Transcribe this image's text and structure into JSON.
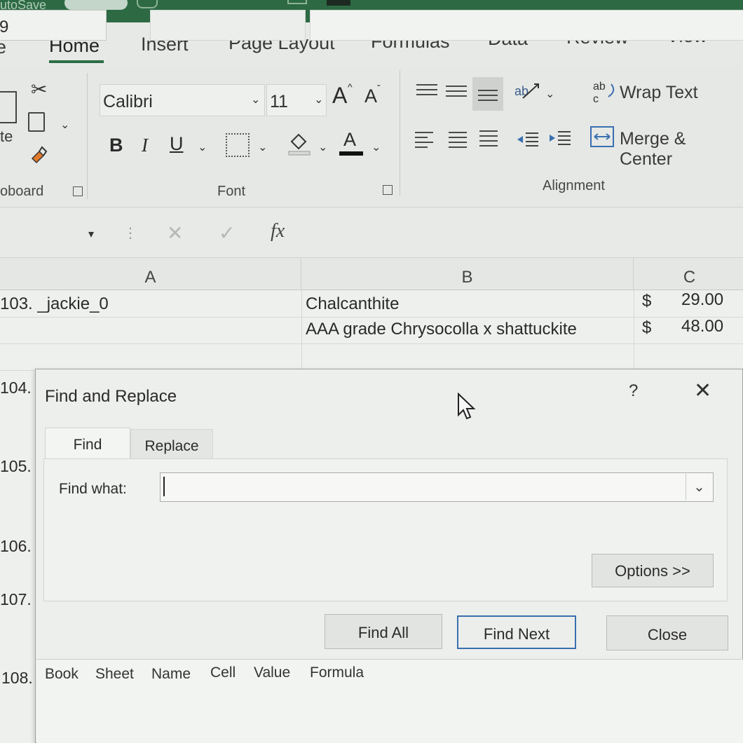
{
  "title_bar": {
    "autosave_label": "utoSave",
    "autosave_state": "Off"
  },
  "tabs": [
    {
      "label": "e"
    },
    {
      "label": "Home"
    },
    {
      "label": "Insert"
    },
    {
      "label": "Page Layout"
    },
    {
      "label": "Formulas"
    },
    {
      "label": "Data"
    },
    {
      "label": "Review"
    },
    {
      "label": "View"
    }
  ],
  "ribbon": {
    "clipboard": {
      "paste_label": "te",
      "group_label": "oboard"
    },
    "font": {
      "name": "Calibri",
      "size": "11",
      "bold": "B",
      "italic": "I",
      "underline": "U",
      "font_color_letter": "A",
      "grow_letter": "A",
      "shrink_letter": "A",
      "group_label": "Font"
    },
    "alignment": {
      "wrap_text": "Wrap Text",
      "merge_center": "Merge & Center",
      "group_label": "Alignment"
    }
  },
  "formula_bar": {
    "name_box": "9",
    "fx": "fx",
    "formula": ""
  },
  "sheet": {
    "columns": [
      "A",
      "B",
      "C"
    ],
    "rows": [
      {
        "a": "103. _jackie_0",
        "b": "Chalcanthite",
        "c_symbol": "$",
        "c_value": "29.00"
      },
      {
        "a": "",
        "b": "AAA grade Chrysocolla x shattuckite",
        "c_symbol": "$",
        "c_value": "48.00"
      }
    ],
    "row_labels": [
      "104.",
      "105.",
      "106.",
      "107.",
      "108."
    ]
  },
  "dialog": {
    "title": "Find and Replace",
    "help": "?",
    "close_glyph": "✕",
    "tabs": [
      "Find",
      "Replace"
    ],
    "find_what_label": "Find what:",
    "find_what_value": "",
    "options_button": "Options >>",
    "find_all_button": "Find All",
    "find_next_button": "Find Next",
    "close_button": "Close",
    "results_columns": [
      "Book",
      "Sheet",
      "Name",
      "Cell",
      "Value",
      "Formula"
    ]
  },
  "colors": {
    "title_bar": "#2d6a43",
    "active_tab_underline": "#2b6e45",
    "default_button_border": "#3a6fb0"
  }
}
